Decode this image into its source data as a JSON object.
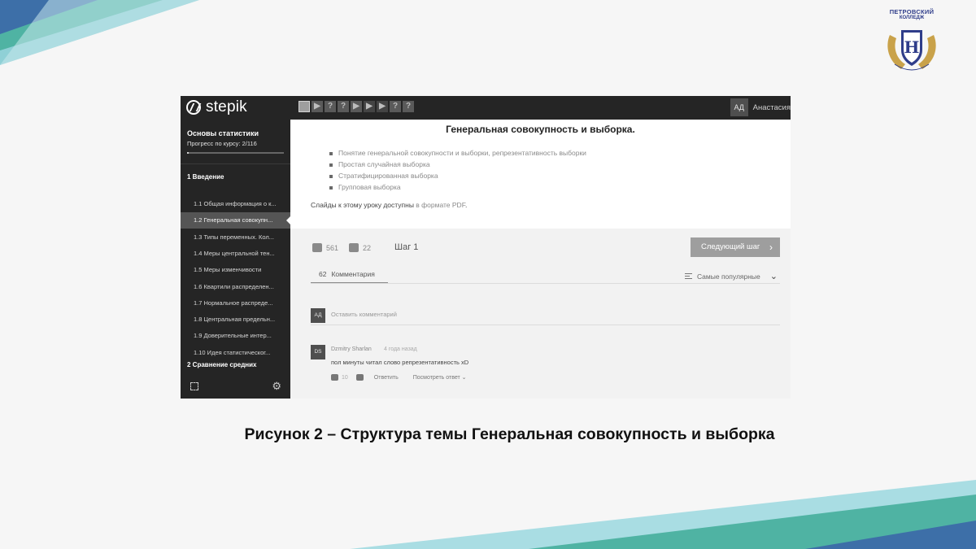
{
  "college_logo": {
    "line1": "ПЕТРОВСКИЙ",
    "line2": "КОЛЛЕДЖ",
    "motto": "LEARNING BY DOING"
  },
  "stepik": {
    "brand": "stepik",
    "step_icons": [
      "square",
      "play",
      "question",
      "question",
      "play",
      "play",
      "play",
      "question",
      "question"
    ],
    "user_initials": "АД",
    "user_name": "Анастасия"
  },
  "sidebar": {
    "course_title": "Основы статистики",
    "progress_label": "Прогресс по курсу:  2/116",
    "progress_fraction": 0.0172,
    "module1": "1  Введение",
    "lessons": [
      "1.1  Общая информация о к...",
      "1.2  Генеральная совокупн...",
      "1.3  Типы переменных. Кол...",
      "1.4  Меры центральной тен...",
      "1.5  Меры изменчивости",
      "1.6  Квартили распределен...",
      "1.7  Нормальное распреде...",
      "1.8  Центральная предельн...",
      "1.9  Доверительные интер...",
      "1.10  Идея статистическог..."
    ],
    "active_lesson_index": 1,
    "module2": "2  Сравнение средних"
  },
  "lesson": {
    "title": "Генеральная совокупность и выборка.",
    "bullets": [
      "Понятие генеральной совокупности и выборки, репрезентативность выборки",
      "Простая случайная выборка",
      "Стратифицированная выборка",
      "Групповая выборка"
    ],
    "slides_text": "Слайды к этому уроку доступны ",
    "slides_link": "в формате PDF",
    "slides_end": "."
  },
  "reactions": {
    "likes": "561",
    "dislikes": "22",
    "step_label": "Шаг 1",
    "next_button": "Следующий шаг"
  },
  "comments": {
    "count": "62",
    "tab_label": "Комментария",
    "sort_label": "Самые популярные",
    "new_avatar": "АД",
    "new_placeholder": "Оставить комментарий",
    "items": [
      {
        "avatar": "DS",
        "author": "Dzmitry Sharlan",
        "time": "4 года назад",
        "text": "пол минуты читал слово репрезентативность xD",
        "likes": "10",
        "reply": "Ответить",
        "show_replies": "Посмотреть ответ"
      }
    ]
  },
  "caption": "Рисунок 2 – Структура темы Генеральная  совокупность и выборка"
}
